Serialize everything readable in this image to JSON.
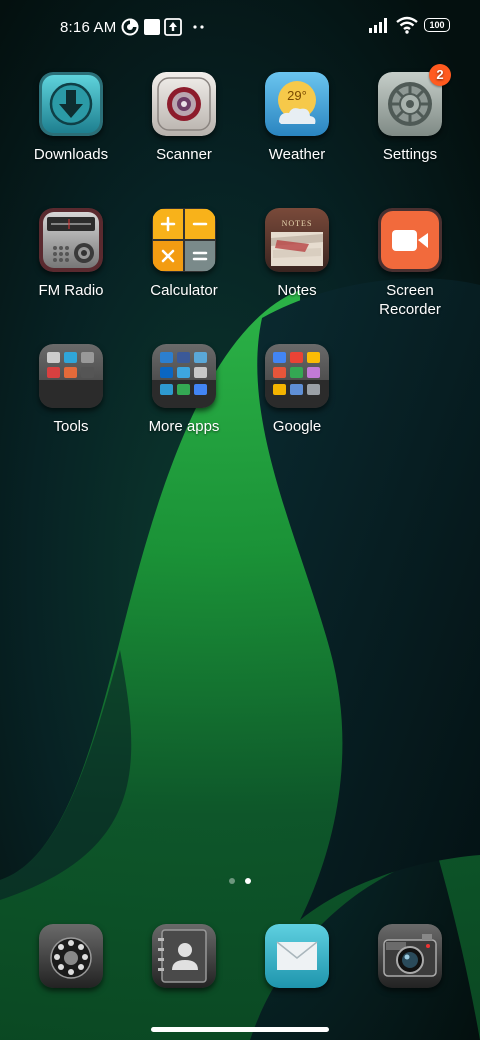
{
  "status_bar": {
    "time": "8:16 AM",
    "battery": "100",
    "icons": [
      "data-saver-icon",
      "square-notification-icon",
      "upload-icon",
      "more-dots-icon",
      "signal-icon",
      "wifi-icon",
      "battery-icon"
    ]
  },
  "apps": [
    {
      "label": "Downloads",
      "icon": "downloads-icon"
    },
    {
      "label": "Scanner",
      "icon": "scanner-icon"
    },
    {
      "label": "Weather",
      "icon": "weather-icon",
      "temp": "29°"
    },
    {
      "label": "Settings",
      "icon": "settings-gear-icon",
      "badge": "2"
    },
    {
      "label": "FM Radio",
      "icon": "fm-radio-icon"
    },
    {
      "label": "Calculator",
      "icon": "calculator-icon"
    },
    {
      "label": "Notes",
      "icon": "notes-icon",
      "title": "NOTES"
    },
    {
      "label": "Screen Recorder",
      "icon": "screen-recorder-icon"
    },
    {
      "label": "Tools",
      "icon": "tools-folder-icon"
    },
    {
      "label": "More apps",
      "icon": "more-apps-folder-icon"
    },
    {
      "label": "Google",
      "icon": "google-folder-icon"
    }
  ],
  "page_indicator": {
    "pages": 2,
    "current": 2
  },
  "dock": [
    {
      "icon": "phone-dialer-icon"
    },
    {
      "icon": "contacts-icon"
    },
    {
      "icon": "messages-icon"
    },
    {
      "icon": "camera-icon"
    }
  ],
  "colors": {
    "badge": "#ff5a1f",
    "wallpaper_green": "#1fa13a",
    "wallpaper_dark": "#061418"
  }
}
